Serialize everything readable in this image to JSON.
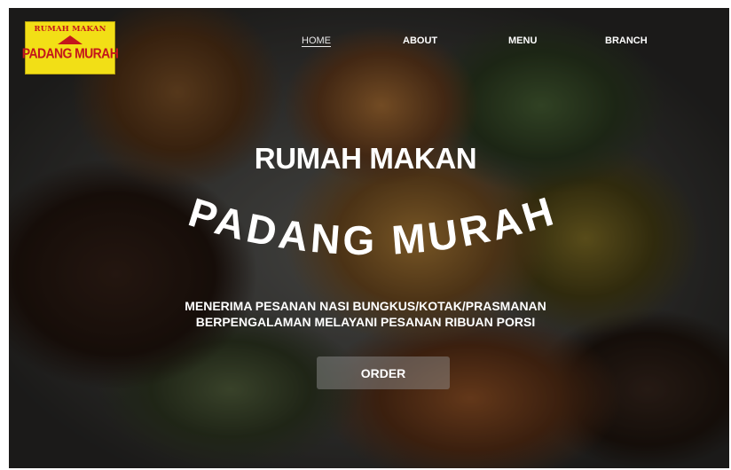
{
  "logo": {
    "top_text": "RUMAH MAKAN",
    "bottom_text": "PADANG MURAH"
  },
  "nav": {
    "items": [
      "HOME",
      "ABOUT",
      "MENU",
      "BRANCH"
    ],
    "active": "HOME"
  },
  "hero": {
    "title": "RUMAH MAKAN",
    "arc_text": "PADANG MURAH",
    "tagline_1": "MENERIMA PESANAN NASI BUNGKUS/KOTAK/PRASMANAN",
    "tagline_2": "BERPENGALAMAN MELAYANI PESANAN RIBUAN PORSI"
  },
  "cta": {
    "order_label": "ORDER"
  },
  "colors": {
    "logo_bg": "#f2df16",
    "logo_text": "#c4161c",
    "text": "#ffffff"
  },
  "icons": {
    "logo": "restaurant-logo-roof"
  }
}
